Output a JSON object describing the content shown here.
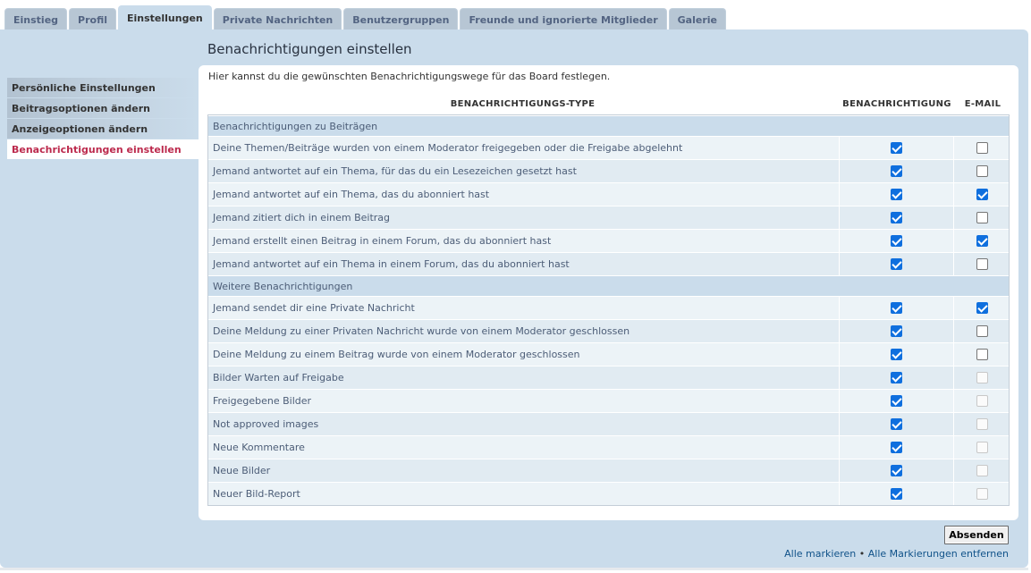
{
  "tabs": [
    {
      "label": "Einstieg",
      "active": false
    },
    {
      "label": "Profil",
      "active": false
    },
    {
      "label": "Einstellungen",
      "active": true
    },
    {
      "label": "Private Nachrichten",
      "active": false
    },
    {
      "label": "Benutzergruppen",
      "active": false
    },
    {
      "label": "Freunde und ignorierte Mitglieder",
      "active": false
    },
    {
      "label": "Galerie",
      "active": false
    }
  ],
  "sidebar": {
    "items": [
      {
        "label": "Persönliche Einstellungen",
        "active": false
      },
      {
        "label": "Beitragsoptionen ändern",
        "active": false
      },
      {
        "label": "Anzeigeoptionen ändern",
        "active": false
      },
      {
        "label": "Benachrichtigungen einstellen",
        "active": true
      }
    ]
  },
  "page": {
    "title": "Benachrichtigungen einstellen",
    "intro": "Hier kannst du die gewünschten Benachrichtigungswege für das Board festlegen."
  },
  "table": {
    "headers": {
      "type": "BENACHRICHTIGUNGS-TYPE",
      "notification": "BENACHRICHTIGUNG",
      "email": "E-MAIL"
    },
    "rows": [
      {
        "section": true,
        "label": "Benachrichtigungen zu Beiträgen"
      },
      {
        "label": "Deine Themen/Beiträge wurden von einem Moderator freigegeben oder die Freigabe abgelehnt",
        "notify": "on",
        "email": "off"
      },
      {
        "label": "Jemand antwortet auf ein Thema, für das du ein Lesezeichen gesetzt hast",
        "notify": "on",
        "email": "off"
      },
      {
        "label": "Jemand antwortet auf ein Thema, das du abonniert hast",
        "notify": "on",
        "email": "on"
      },
      {
        "label": "Jemand zitiert dich in einem Beitrag",
        "notify": "on",
        "email": "off"
      },
      {
        "label": "Jemand erstellt einen Beitrag in einem Forum, das du abonniert hast",
        "notify": "on",
        "email": "on"
      },
      {
        "label": "Jemand antwortet auf ein Thema in einem Forum, das du abonniert hast",
        "notify": "on",
        "email": "off"
      },
      {
        "section": true,
        "label": "Weitere Benachrichtigungen"
      },
      {
        "label": "Jemand sendet dir eine Private Nachricht",
        "notify": "on",
        "email": "on"
      },
      {
        "label": "Deine Meldung zu einer Privaten Nachricht wurde von einem Moderator geschlossen",
        "notify": "on",
        "email": "off"
      },
      {
        "label": "Deine Meldung zu einem Beitrag wurde von einem Moderator geschlossen",
        "notify": "on",
        "email": "off"
      },
      {
        "label": "Bilder Warten auf Freigabe",
        "notify": "on",
        "email": "disabled"
      },
      {
        "label": "Freigegebene Bilder",
        "notify": "on",
        "email": "disabled"
      },
      {
        "label": "Not approved images",
        "notify": "on",
        "email": "disabled"
      },
      {
        "label": "Neue Kommentare",
        "notify": "on",
        "email": "disabled"
      },
      {
        "label": "Neue Bilder",
        "notify": "on",
        "email": "disabled"
      },
      {
        "label": "Neuer Bild-Report",
        "notify": "on",
        "email": "disabled"
      }
    ]
  },
  "footer": {
    "submit_label": "Absenden",
    "mark_all": "Alle markieren",
    "separator": "•",
    "unmark_all": "Alle Markierungen entfernen"
  },
  "colors": {
    "panel_bg": "#cadceb",
    "active_menu_text": "#bc2a4d",
    "checkbox_checked": "#0f6fde",
    "link": "#105289"
  }
}
